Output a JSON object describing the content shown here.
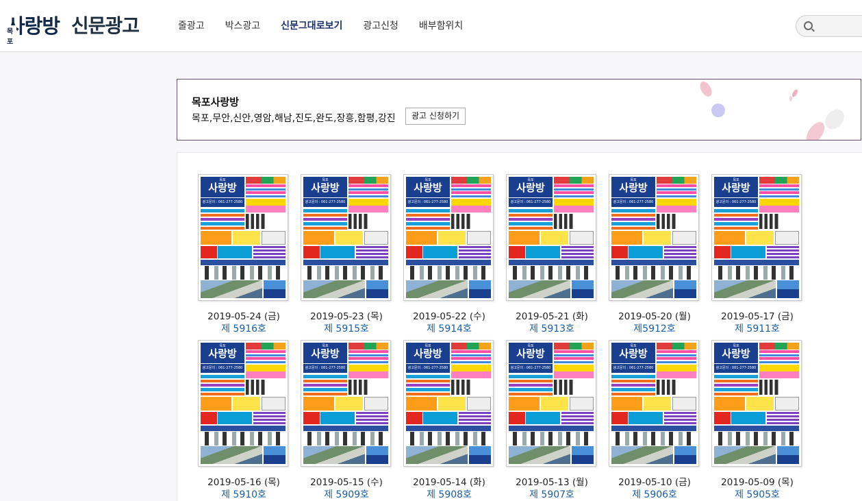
{
  "header": {
    "logo_main": "사랑방",
    "logo_region": "목포",
    "logo_sub": "신문광고",
    "nav": [
      {
        "label": "줄광고",
        "active": false
      },
      {
        "label": "박스광고",
        "active": false
      },
      {
        "label": "신문그대로보기",
        "active": true
      },
      {
        "label": "광고신청",
        "active": false
      },
      {
        "label": "배부함위치",
        "active": false
      }
    ],
    "search": {
      "value": ""
    }
  },
  "banner": {
    "title": "목포사랑방",
    "regions": "목포,무안,신안,영암,해남,진도,완도,장흥,함평,강진",
    "button_label": "광고 신청하기"
  },
  "thumb_text": {
    "region": "목포",
    "title": "사랑방",
    "phone": "광고문의 : 061-277-2580"
  },
  "issues": [
    {
      "date": "2019-05-24 (금)",
      "issue": "제 5916호"
    },
    {
      "date": "2019-05-23 (목)",
      "issue": "제 5915호"
    },
    {
      "date": "2019-05-22 (수)",
      "issue": "제 5914호"
    },
    {
      "date": "2019-05-21 (화)",
      "issue": "제 5913호"
    },
    {
      "date": "2019-05-20 (월)",
      "issue": "제5912호"
    },
    {
      "date": "2019-05-17 (금)",
      "issue": "제 5911호"
    },
    {
      "date": "2019-05-16 (목)",
      "issue": "제 5910호"
    },
    {
      "date": "2019-05-15 (수)",
      "issue": "제 5909호"
    },
    {
      "date": "2019-05-14 (화)",
      "issue": "제 5908호"
    },
    {
      "date": "2019-05-13 (월)",
      "issue": "제 5907호"
    },
    {
      "date": "2019-05-10 (금)",
      "issue": "제 5906호"
    },
    {
      "date": "2019-05-09 (목)",
      "issue": "제 5905호"
    }
  ],
  "colors": {
    "brand_navy": "#13294b",
    "nav_active": "#1a2f6a",
    "issue_link": "#1a5fa5",
    "banner_border": "#6b4f7a"
  }
}
